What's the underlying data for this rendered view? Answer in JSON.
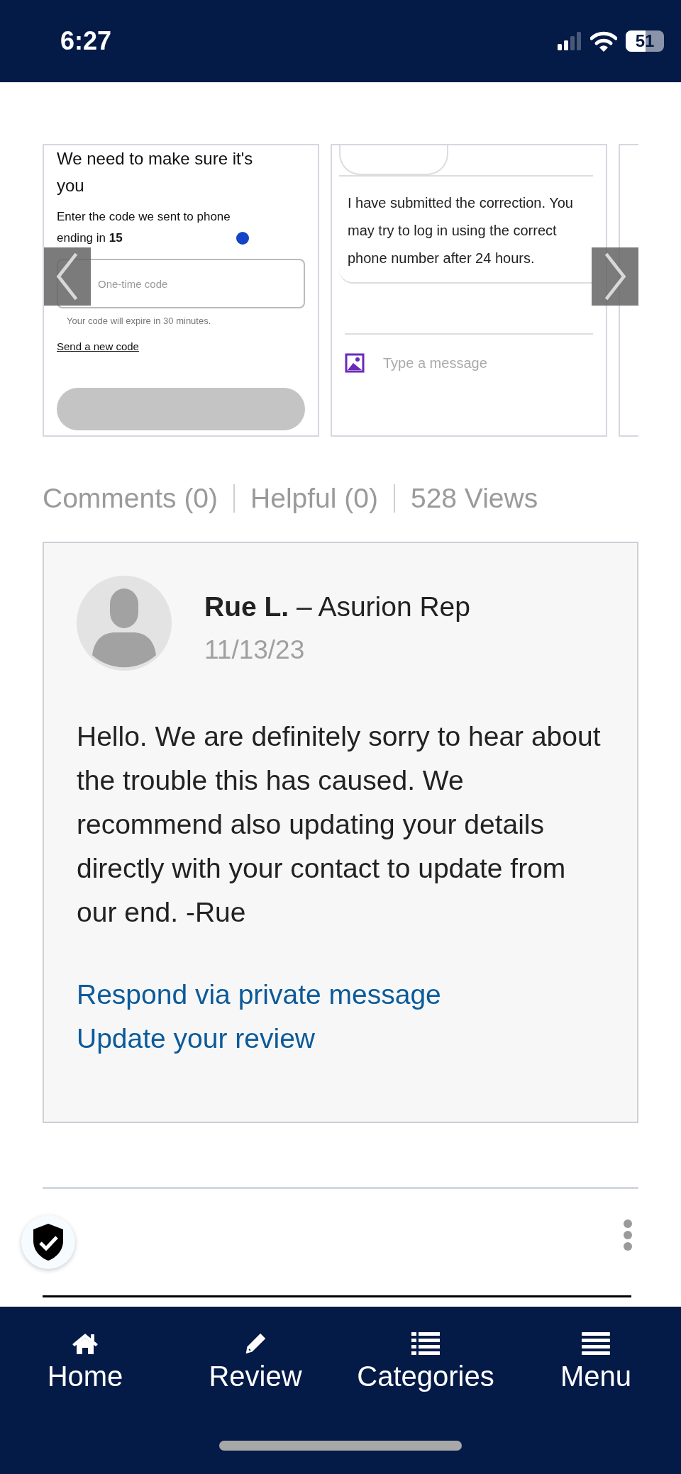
{
  "status_bar": {
    "time": "6:27",
    "battery": "51"
  },
  "gallery": {
    "images": [
      {
        "kind": "verify_screen",
        "title": "We need to make sure it's you",
        "instruction": "Enter the code we sent to phone ending in **15**",
        "field_placeholder": "One-time code",
        "note": "Your code will expire in 30 minutes.",
        "link": "Send a new code"
      },
      {
        "kind": "chat_screen",
        "message": "I have submitted the correction. You may try to log in using the correct phone number after 24 hours.",
        "input_placeholder": "Type a message"
      },
      {
        "kind": "blank"
      }
    ]
  },
  "stats": [
    "Comments (0)",
    "Helpful (0)",
    "528 Views"
  ],
  "response": {
    "author": "**Rue L.** – Asurion Rep",
    "date": "11/13/23",
    "body": "Hello. We are definitely sorry to hear about the trouble this has caused. We recommend also updating your details directly with your contact to update from our end. -Rue",
    "links": [
      "Respond via private message",
      "Update your review"
    ]
  },
  "nav": [
    {
      "label": "Home",
      "kind": "home"
    },
    {
      "label": "Review",
      "kind": "review"
    },
    {
      "label": "Categories",
      "kind": "categories"
    },
    {
      "label": "Menu",
      "kind": "menu"
    }
  ]
}
